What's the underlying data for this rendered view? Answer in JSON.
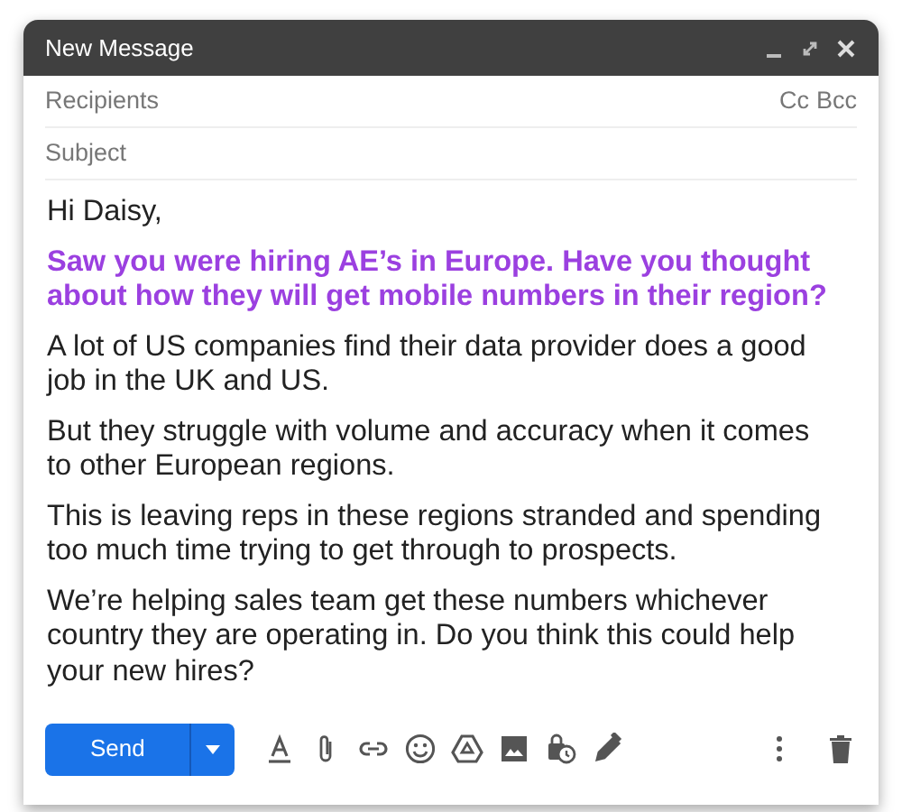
{
  "window": {
    "title": "New Message"
  },
  "recipients": {
    "placeholder": "Recipients",
    "cc": "Cc",
    "bcc": "Bcc"
  },
  "subject": {
    "placeholder": "Subject"
  },
  "body": [
    {
      "kind": "normal",
      "text": "Hi Daisy,"
    },
    {
      "kind": "highlight",
      "text": "Saw you were hiring AE’s in Europe. Have you thought about how they will get mobile numbers in their region?"
    },
    {
      "kind": "normal",
      "text": "A lot of US companies find their data provider does a good job in the UK and US."
    },
    {
      "kind": "normal",
      "text": "But  they struggle with volume and accuracy when it comes to other European regions."
    },
    {
      "kind": "normal",
      "text": "This is leaving reps in these regions stranded and spending too much time trying to get through to prospects."
    },
    {
      "kind": "normal",
      "text": "We’re helping sales team get these numbers whichever country they are operating in. Do you think this could help your new hires?"
    }
  ],
  "toolbar": {
    "send": "Send"
  }
}
